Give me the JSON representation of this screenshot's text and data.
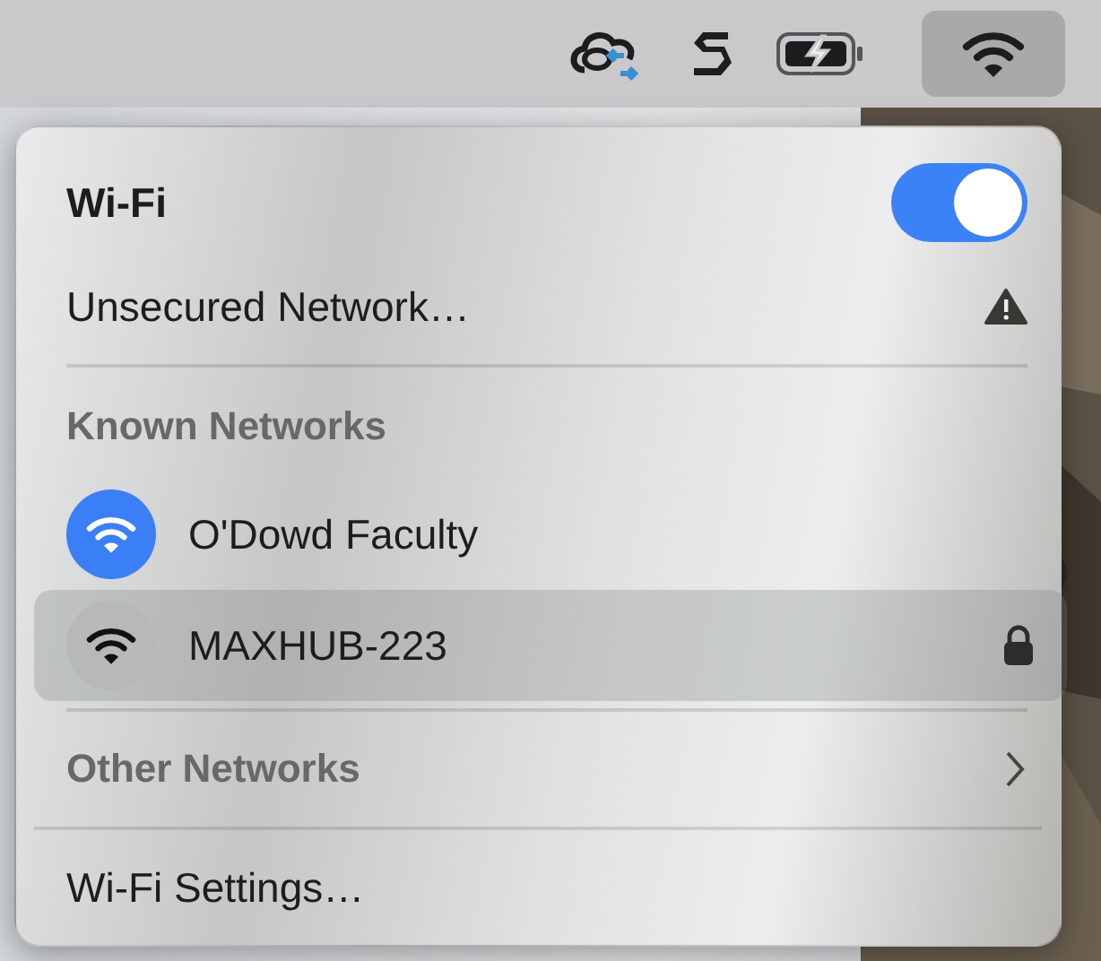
{
  "menu_bar": {
    "status_icons": [
      {
        "kind": "cloud",
        "selected": false
      },
      {
        "kind": "letter",
        "selected": false
      },
      {
        "kind": "battery",
        "selected": false
      },
      {
        "kind": "wifi",
        "selected": true
      }
    ]
  },
  "wifi_menu": {
    "title": "Wi-Fi",
    "on": true,
    "unsecured": {
      "label": "Unsecured Network…",
      "warning": true
    },
    "known_header": "Known Networks",
    "known_networks": [
      {
        "name": "O'Dowd Faculty",
        "connected": true,
        "locked": false,
        "selected": false
      },
      {
        "name": "MAXHUB-223",
        "connected": false,
        "locked": true,
        "selected": true
      }
    ],
    "other_networks": {
      "label": "Other Networks",
      "expanded": false
    },
    "settings": "Wi-Fi Settings…"
  }
}
